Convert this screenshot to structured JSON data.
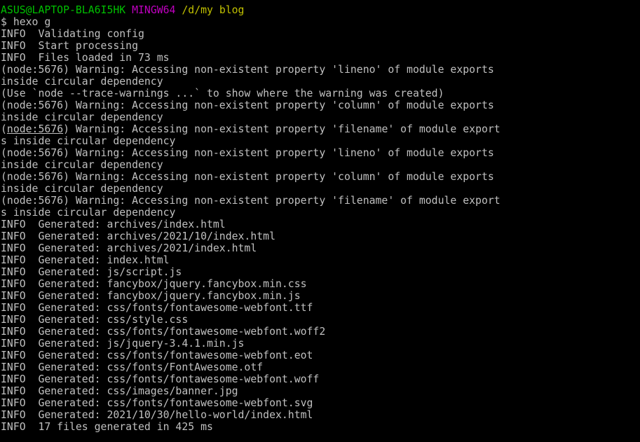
{
  "terminal": {
    "colors": {
      "background": "#000000",
      "text": "#c0c0c0",
      "prompt_user": "#00c000",
      "prompt_env": "#c000c0",
      "prompt_path": "#c0c000"
    },
    "prompt": {
      "user_host": "ASUS@LAPTOP-BLA6I5HK",
      "env": "MINGW64",
      "path": "/d/my blog"
    },
    "command": "$ hexo g",
    "lines": [
      "INFO  Validating config",
      "INFO  Start processing",
      "INFO  Files loaded in 73 ms",
      "(node:5676) Warning: Accessing non-existent property 'lineno' of module exports",
      "inside circular dependency",
      "(Use `node --trace-warnings ...` to show where the warning was created)",
      "(node:5676) Warning: Accessing non-existent property 'column' of module exports",
      "inside circular dependency",
      "(node:5676) Warning: Accessing non-existent property 'filename' of module export",
      "s inside circular dependency",
      "(node:5676) Warning: Accessing non-existent property 'lineno' of module exports",
      "inside circular dependency",
      "(node:5676) Warning: Accessing non-existent property 'column' of module exports",
      "inside circular dependency",
      "(node:5676) Warning: Accessing non-existent property 'filename' of module export",
      "s inside circular dependency",
      "INFO  Generated: archives/index.html",
      "INFO  Generated: archives/2021/10/index.html",
      "INFO  Generated: archives/2021/index.html",
      "INFO  Generated: index.html",
      "INFO  Generated: js/script.js",
      "INFO  Generated: fancybox/jquery.fancybox.min.css",
      "INFO  Generated: fancybox/jquery.fancybox.min.js",
      "INFO  Generated: css/fonts/fontawesome-webfont.ttf",
      "INFO  Generated: css/style.css",
      "INFO  Generated: css/fonts/fontawesome-webfont.woff2",
      "INFO  Generated: js/jquery-3.4.1.min.js",
      "INFO  Generated: css/fonts/fontawesome-webfont.eot",
      "INFO  Generated: css/fonts/FontAwesome.otf",
      "INFO  Generated: css/fonts/fontawesome-webfont.woff",
      "INFO  Generated: css/images/banner.jpg",
      "INFO  Generated: css/fonts/fontawesome-webfont.svg",
      "INFO  Generated: 2021/10/30/hello-world/index.html",
      "INFO  17 files generated in 425 ms"
    ]
  }
}
